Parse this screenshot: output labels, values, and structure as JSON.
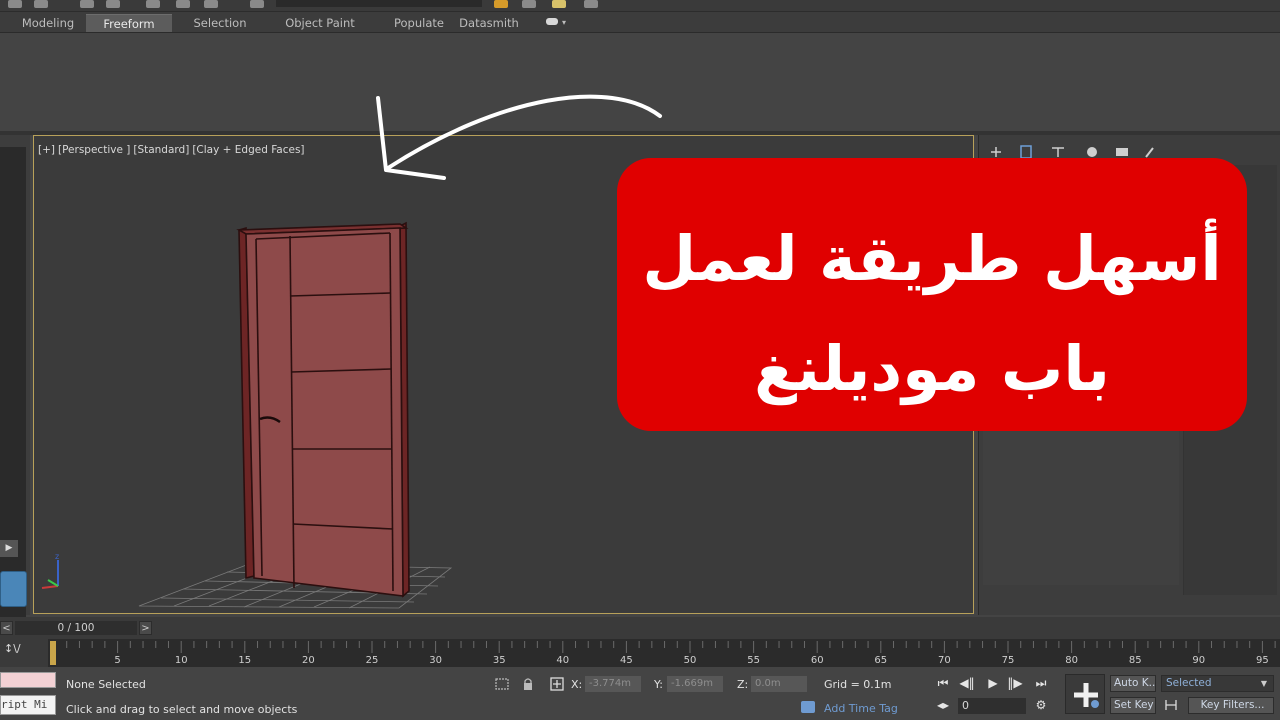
{
  "ribbon": {
    "tabs": [
      {
        "label": "Modeling",
        "active": false
      },
      {
        "label": "Freeform",
        "active": true
      },
      {
        "label": "Selection",
        "active": false
      },
      {
        "label": "Object Paint",
        "active": false
      },
      {
        "label": "Populate",
        "active": false
      },
      {
        "label": "Datasmith",
        "active": false
      }
    ]
  },
  "viewport": {
    "label_parts": [
      "[+]",
      "[Perspective ]",
      "[Standard]",
      "[Clay + Edged Faces]"
    ],
    "border_color": "#b8a15a",
    "door_color": "#8e4a4a"
  },
  "banner": {
    "line1": "أسهل طريقة لعمل",
    "line2": "باب موديلنغ",
    "background": "#e00000",
    "text_color": "#ffffff"
  },
  "time_slider": {
    "frame_display": "0 / 100",
    "prev": "<",
    "next": ">"
  },
  "track_bar": {
    "curve_icon": "↕\\/",
    "ticks": [
      5,
      10,
      15,
      20,
      25,
      30,
      35,
      40,
      45,
      50,
      55,
      60,
      65,
      70,
      75,
      80,
      85,
      90,
      95
    ]
  },
  "status_bar": {
    "maxscript_text": "ript Mi",
    "selection_status": "None Selected",
    "prompt": "Click and drag to select and move objects",
    "x_label": "X:",
    "x_value": "-3.774m",
    "y_label": "Y:",
    "y_value": "-1.669m",
    "z_label": "Z:",
    "z_value": "0.0m",
    "grid": "Grid = 0.1m",
    "add_time_tag": "Add Time Tag",
    "current_frame": "0",
    "auto_key": "Auto K...",
    "set_key": "Set Key",
    "key_filter_select": "Selected",
    "key_filters": "Key Filters..."
  }
}
